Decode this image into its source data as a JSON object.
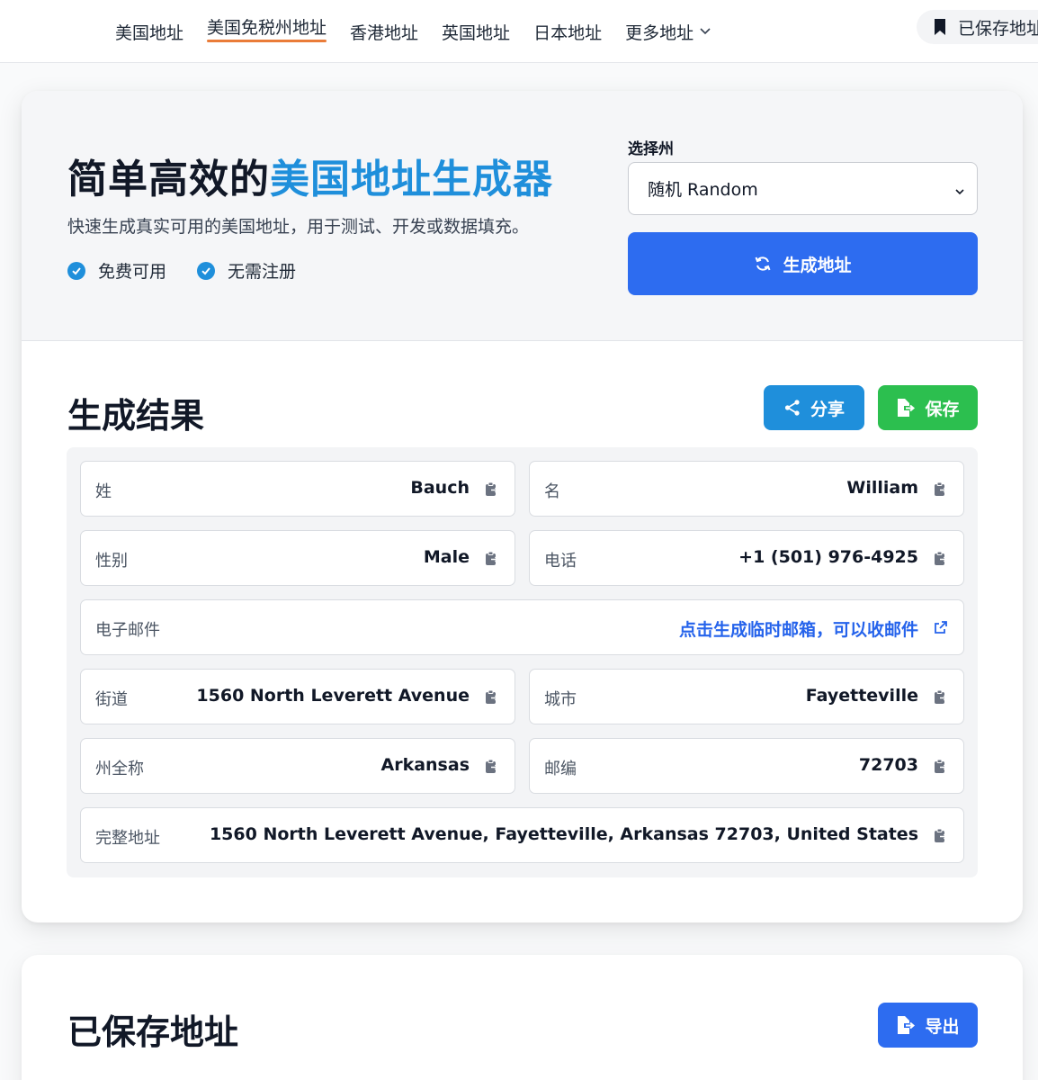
{
  "nav": {
    "links": [
      "美国地址",
      "美国免税州地址",
      "香港地址",
      "英国地址",
      "日本地址",
      "更多地址"
    ],
    "active_index": 1,
    "saved_label": "已保存地址"
  },
  "hero": {
    "title_main": "简单高效的",
    "title_accent": "美国地址生成器",
    "subtitle": "快速生成真实可用的美国地址，用于测试、开发或数据填充。",
    "features": [
      "免费可用",
      "无需注册"
    ],
    "state_label": "选择州",
    "state_value": "随机 Random",
    "generate_label": "生成地址"
  },
  "results": {
    "title": "生成结果",
    "share_label": "分享",
    "save_label": "保存",
    "fields": {
      "last_name": {
        "label": "姓",
        "value": "Bauch"
      },
      "first_name": {
        "label": "名",
        "value": "William"
      },
      "gender": {
        "label": "性别",
        "value": "Male"
      },
      "phone": {
        "label": "电话",
        "value": "+1 (501) 976-4925"
      },
      "email": {
        "label": "电子邮件",
        "value": "点击生成临时邮箱，可以收邮件"
      },
      "street": {
        "label": "街道",
        "value": "1560 North Leverett Avenue"
      },
      "city": {
        "label": "城市",
        "value": "Fayetteville"
      },
      "state": {
        "label": "州全称",
        "value": "Arkansas"
      },
      "zip": {
        "label": "邮编",
        "value": "72703"
      },
      "full": {
        "label": "完整地址",
        "value": "1560 North Leverett Avenue, Fayetteville, Arkansas 72703, United States"
      }
    }
  },
  "saved": {
    "title": "已保存地址",
    "export_label": "导出"
  },
  "colors": {
    "accent_blue": "#1f8fdb",
    "primary": "#2d6cf0",
    "success": "#2cbf4f",
    "nav_underline": "#ea7c39"
  }
}
